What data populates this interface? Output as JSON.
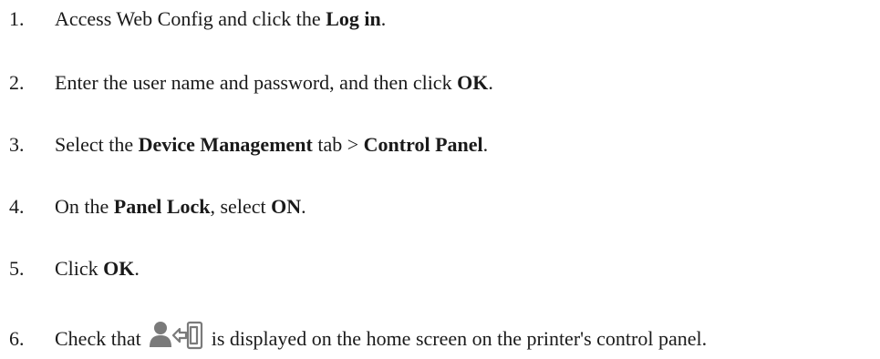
{
  "steps": [
    {
      "number": "1.",
      "t1": "Access Web Config and click the ",
      "b1": "Log in",
      "t2": "."
    },
    {
      "number": "2.",
      "t1": "Enter the user name and password, and then click ",
      "b1": "OK",
      "t2": "."
    },
    {
      "number": "3.",
      "t1": "Select the ",
      "b1": "Device Management",
      "t2": " tab > ",
      "b2": "Control Panel",
      "t3": "."
    },
    {
      "number": "4.",
      "t1": "On the ",
      "b1": "Panel Lock",
      "t2": ", select ",
      "b2": "ON",
      "t3": "."
    },
    {
      "number": "5.",
      "t1": "Click ",
      "b1": "OK",
      "t2": "."
    },
    {
      "number": "6.",
      "t1": "Check that ",
      "icon": "user-logout-icon",
      "t2": " is displayed on the home screen on the printer's control panel."
    }
  ],
  "colors": {
    "text": "#1a1a1a",
    "icon": "#7a7a7a"
  }
}
